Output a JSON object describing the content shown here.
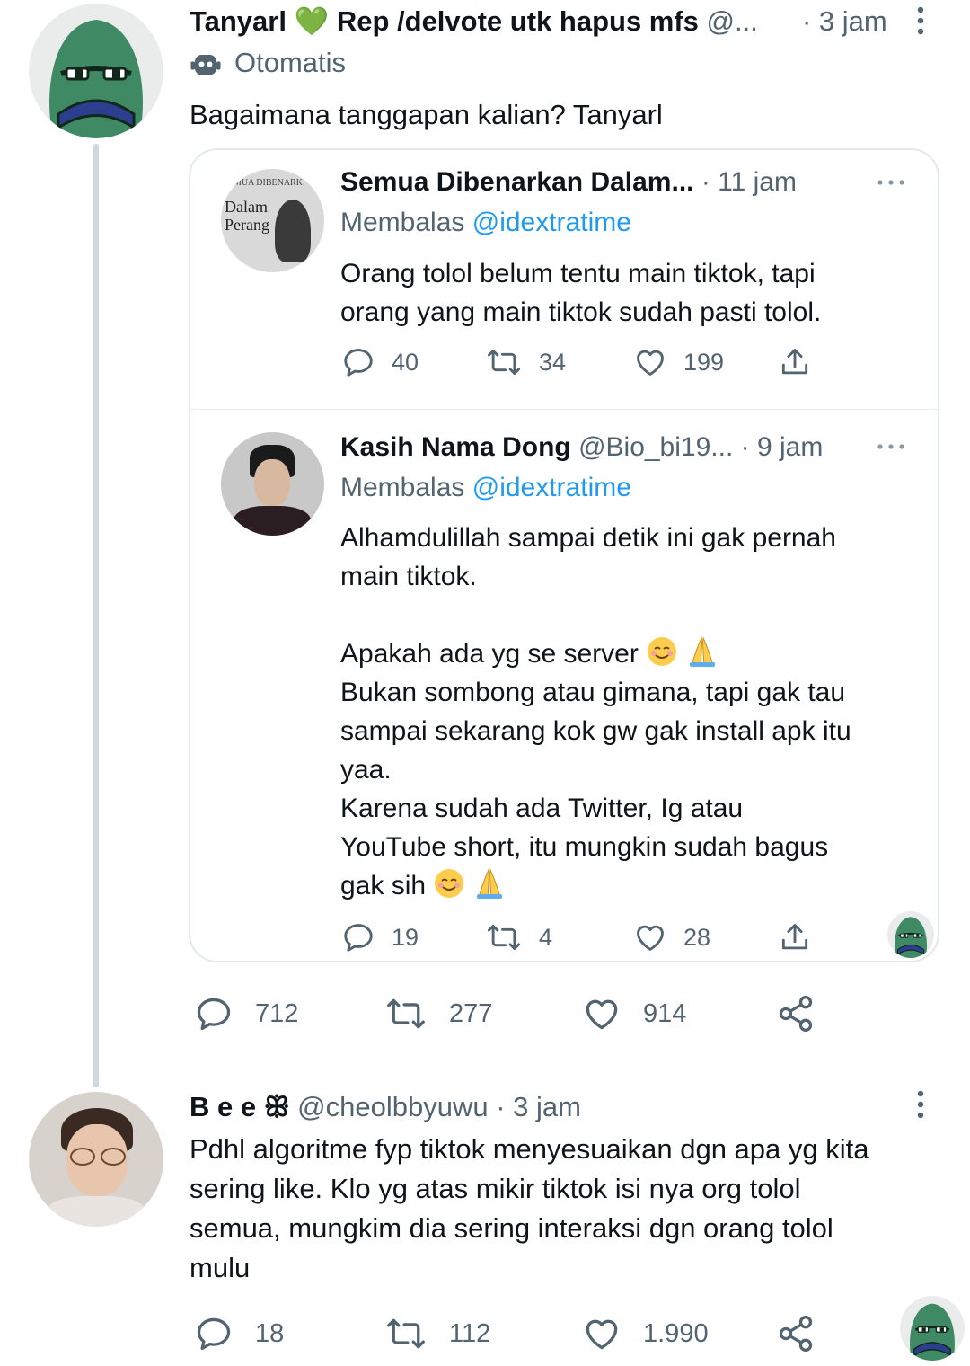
{
  "colors": {
    "accent": "#1d9bf0",
    "muted": "#536471",
    "border": "#cfd9de",
    "heart": "#00ba7c"
  },
  "tweet1": {
    "name": "Tanyarl",
    "heart_emoji": "💚",
    "name_rest": "Rep /delvote utk hapus mfs",
    "handle": "@...",
    "time": "· 3 jam",
    "automated_label": "Otomatis",
    "text": "Bagaimana tanggapan kalian? Tanyarl",
    "stats": {
      "replies": "712",
      "retweets": "277",
      "likes": "914"
    }
  },
  "quote1": {
    "avatar_text_top": "MUA DIBENARK",
    "avatar_text_1": "Dalam",
    "avatar_text_2": "Perang",
    "name": "Semua Dibenarkan Dalam...",
    "time": "· 11 jam",
    "reply_prefix": "Membalas",
    "reply_to": "@idextratime",
    "line1": "Orang tolol belum tentu main tiktok, tapi",
    "line2": "orang yang main tiktok sudah pasti tolol.",
    "stats": {
      "replies": "40",
      "retweets": "34",
      "likes": "199"
    }
  },
  "quote2": {
    "name": "Kasih Nama Dong",
    "handle": "@Bio_bi19...",
    "time": "· 9 jam",
    "reply_prefix": "Membalas",
    "reply_to": "@idextratime",
    "line1": "Alhamdulillah sampai detik ini gak pernah",
    "line2": "main tiktok.",
    "line3": "Apakah ada yg se server",
    "line4": "Bukan sombong atau gimana, tapi gak tau",
    "line5": "sampai sekarang kok gw gak install apk itu",
    "line6": "yaa.",
    "line7": "Karena sudah ada Twitter, Ig atau",
    "line8": "YouTube short, itu mungkin sudah bagus",
    "line9": "gak sih",
    "stats": {
      "replies": "19",
      "retweets": "4",
      "likes": "28"
    }
  },
  "tweet2": {
    "name": "B e e",
    "name_symbol": "ꕥ",
    "handle": "@cheolbbyuwu",
    "time": "· 3 jam",
    "line1": "Pdhl algoritme fyp tiktok menyesuaikan dgn apa yg kita",
    "line2": "sering like. Klo yg atas mikir tiktok isi nya org tolol",
    "line3": "semua, mungkim dia sering interaksi dgn orang tolol",
    "line4": "mulu",
    "stats": {
      "replies": "18",
      "retweets": "112",
      "likes": "1.990"
    }
  }
}
